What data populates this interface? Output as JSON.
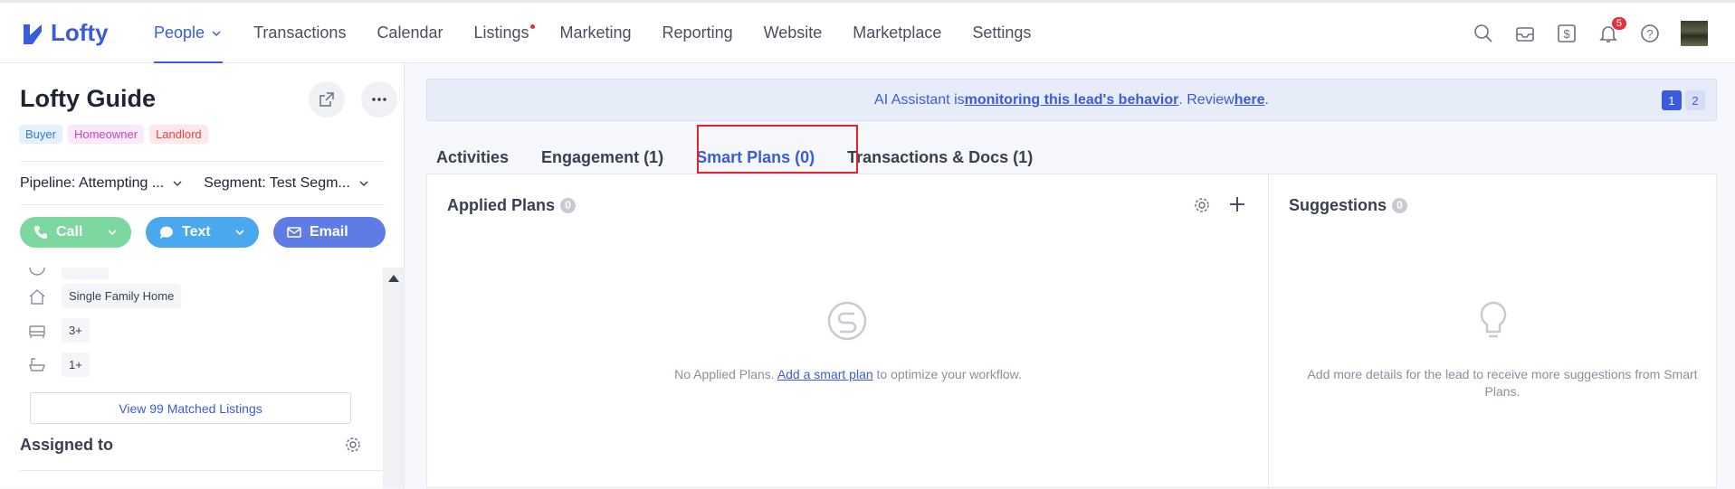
{
  "app": {
    "logo_text": "Lofty"
  },
  "nav": {
    "items": [
      {
        "label": "People"
      },
      {
        "label": "Transactions"
      },
      {
        "label": "Calendar"
      },
      {
        "label": "Listings"
      },
      {
        "label": "Marketing"
      },
      {
        "label": "Reporting"
      },
      {
        "label": "Website"
      },
      {
        "label": "Marketplace"
      },
      {
        "label": "Settings"
      }
    ],
    "notification_count": "5"
  },
  "lead": {
    "name": "Lofty Guide",
    "tags": [
      "Buyer",
      "Homeowner",
      "Landlord"
    ],
    "pipeline": "Pipeline: Attempting ...",
    "segment": "Segment: Test Segm...",
    "actions": {
      "call": "Call",
      "text": "Text",
      "email": "Email"
    },
    "properties": {
      "type": "Single Family Home",
      "beds": "3+",
      "baths": "1+"
    },
    "matched_listings": "View 99 Matched Listings",
    "assigned_label": "Assigned to"
  },
  "banner": {
    "prefix": "AI Assistant is ",
    "link1": "monitoring this lead's behavior",
    "middle": ". Review ",
    "link2": "here",
    "suffix": ".",
    "pages": [
      "1",
      "2"
    ]
  },
  "tabs": [
    {
      "label": "Activities"
    },
    {
      "label": "Engagement (1)"
    },
    {
      "label": "Smart Plans (0)"
    },
    {
      "label": "Transactions & Docs (1)"
    }
  ],
  "applied": {
    "title": "Applied Plans",
    "count": "0",
    "empty_prefix": "No Applied Plans. ",
    "empty_link": "Add a smart plan",
    "empty_suffix": " to optimize your workflow."
  },
  "suggestions": {
    "title": "Suggestions",
    "count": "0",
    "empty_text": "Add more details for the lead to receive more suggestions from Smart Plans."
  },
  "colors": {
    "accent": "#3a5bdc",
    "highlight": "#e0232e"
  }
}
